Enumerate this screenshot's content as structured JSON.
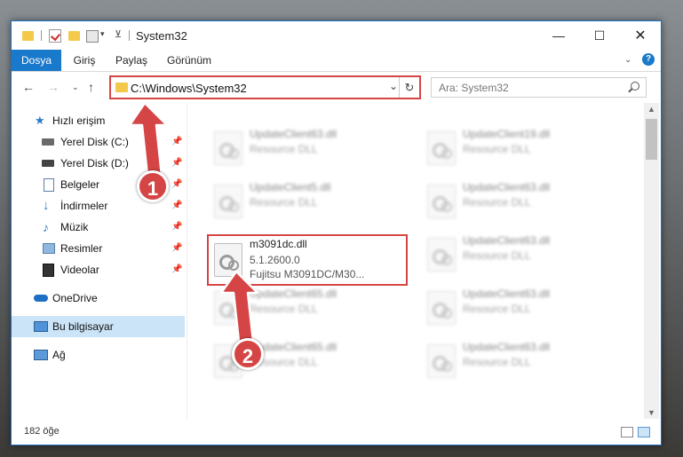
{
  "window": {
    "title": "System32"
  },
  "ribbon": {
    "tabs": [
      {
        "label": "Dosya",
        "active": true
      },
      {
        "label": "Giriş",
        "active": false
      },
      {
        "label": "Paylaş",
        "active": false
      },
      {
        "label": "Görünüm",
        "active": false
      }
    ],
    "help": "?"
  },
  "address": {
    "path": "C:\\Windows\\System32",
    "search_placeholder": "Ara: System32"
  },
  "sidebar": {
    "items": [
      {
        "label": "Hızlı erişim",
        "icon": "star-icon",
        "pinned": false
      },
      {
        "label": "Yerel Disk (C:)",
        "icon": "drive-icon",
        "pinned": true
      },
      {
        "label": "Yerel Disk (D:)",
        "icon": "drive-icon",
        "pinned": true
      },
      {
        "label": "Belgeler",
        "icon": "documents-icon",
        "pinned": true
      },
      {
        "label": "İndirmeler",
        "icon": "download-icon",
        "pinned": true
      },
      {
        "label": "Müzik",
        "icon": "music-icon",
        "pinned": true
      },
      {
        "label": "Resimler",
        "icon": "pictures-icon",
        "pinned": true
      },
      {
        "label": "Videolar",
        "icon": "videos-icon",
        "pinned": true
      },
      {
        "label": "OneDrive",
        "icon": "cloud-icon",
        "pinned": false
      },
      {
        "label": "Bu bilgisayar",
        "icon": "computer-icon",
        "pinned": false,
        "selected": true
      },
      {
        "label": "Ağ",
        "icon": "network-icon",
        "pinned": false
      }
    ]
  },
  "files": [
    {
      "name": "UpdateClient63.dll",
      "type": "Resource DLL"
    },
    {
      "name": "UpdateClient19.dll",
      "type": "Resource DLL"
    },
    {
      "name": "UpdateClient5.dll",
      "type": "Resource DLL"
    },
    {
      "name": "UpdateClient63.dll",
      "type": "Resource DLL"
    },
    {
      "name": "m3091dc.dll",
      "version": "5.1.2600.0",
      "description": "Fujitsu M3091DC/M30...",
      "highlighted": true
    },
    {
      "name": "UpdateClient63.dll",
      "type": "Resource DLL"
    },
    {
      "name": "UpdateClient65.dll",
      "type": "Resource DLL"
    },
    {
      "name": "UpdateClient63.dll",
      "type": "Resource DLL"
    },
    {
      "name": "UpdateClient65.dll",
      "type": "Resource DLL"
    },
    {
      "name": "UpdateClient63.dll",
      "type": "Resource DLL"
    }
  ],
  "status": {
    "count": "182 öğe"
  },
  "annotations": {
    "step1": "1",
    "step2": "2"
  },
  "colors": {
    "accent": "#1979ca",
    "annotation": "#d64545",
    "selection": "#cce4f7"
  }
}
